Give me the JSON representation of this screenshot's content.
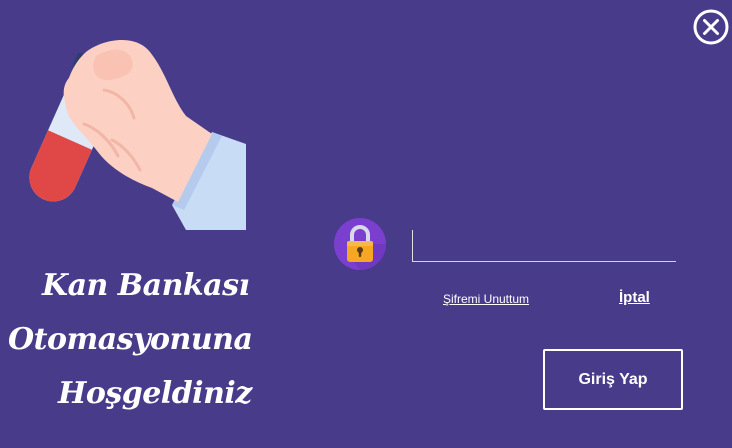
{
  "window": {
    "close_icon": "close-circle-x-icon"
  },
  "illustration": {
    "icon": "hand-holding-blood-test-tube"
  },
  "welcome": {
    "line1": "Kan Bankası",
    "line2": "Otomasyonuna",
    "line3": "Hoşgeldiniz"
  },
  "login": {
    "lock_icon": "padlock-icon",
    "password_value": "",
    "forgot_password_label": "Şifremi Unuttum",
    "cancel_label": "İptal",
    "login_button_label": "Giriş Yap"
  },
  "colors": {
    "background": "#483c8a",
    "text": "#ffffff",
    "lock_circle": "#7b3fcf",
    "lock_body": "#f5a623",
    "blood": "#e04848",
    "skin": "#fcd1c4",
    "sleeve": "#c9dcf5"
  }
}
